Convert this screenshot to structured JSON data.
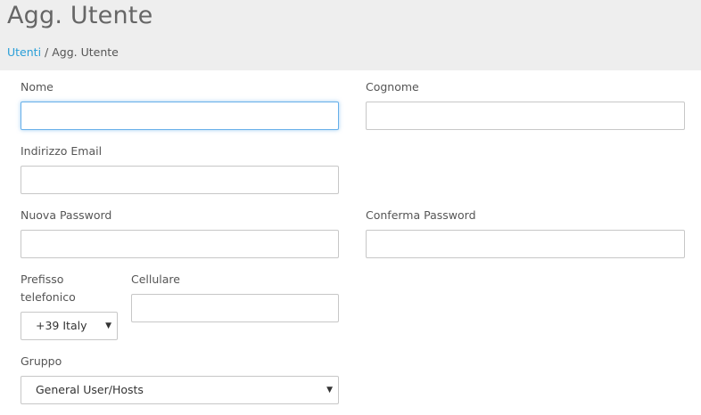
{
  "header": {
    "title": "Agg. Utente",
    "breadcrumb": {
      "link_label": "Utenti",
      "separator": " / ",
      "current_label": "Agg. Utente"
    }
  },
  "form": {
    "nome": {
      "label": "Nome",
      "value": ""
    },
    "cognome": {
      "label": "Cognome",
      "value": ""
    },
    "email": {
      "label": "Indirizzo Email",
      "value": ""
    },
    "password": {
      "label": "Nuova Password",
      "value": ""
    },
    "confirm_password": {
      "label": "Conferma Password",
      "value": ""
    },
    "prefix": {
      "label": "Prefisso telefonico",
      "selected": "+39 Italy"
    },
    "cellulare": {
      "label": "Cellulare",
      "value": ""
    },
    "gruppo": {
      "label": "Gruppo",
      "selected": "General User/Hosts"
    }
  },
  "colors": {
    "header_bg": "#eeeeee",
    "link": "#2a9fd8",
    "focus_border": "#66afe9"
  }
}
